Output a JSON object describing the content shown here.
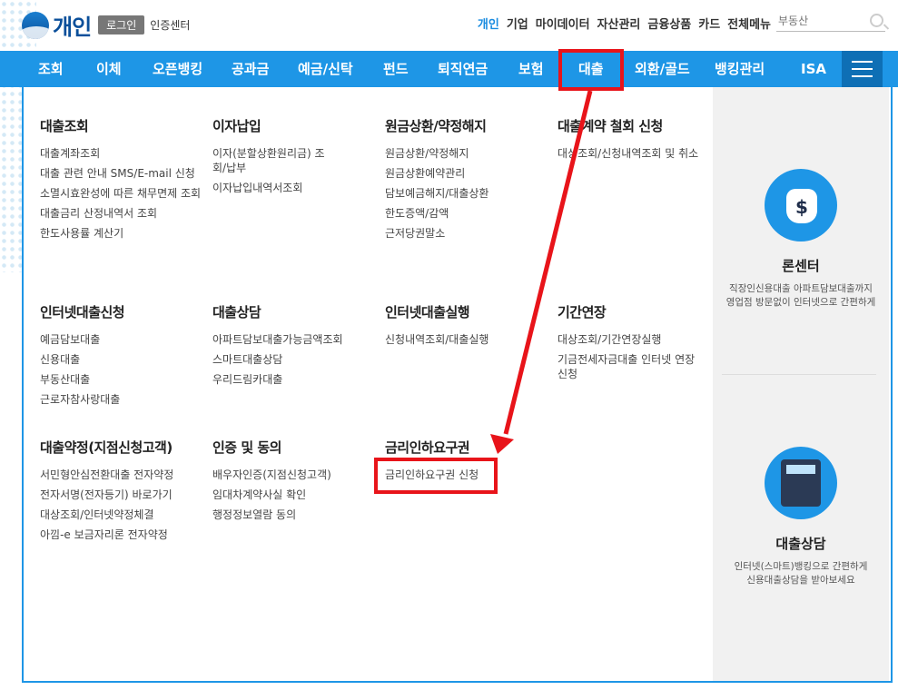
{
  "header": {
    "brand": "개인",
    "login_label": "로그인",
    "cert_label": "인증센터",
    "topnav": [
      "개인",
      "기업",
      "마이데이터",
      "자산관리",
      "금융상품",
      "카드",
      "전체메뉴"
    ],
    "search_placeholder": "부동산"
  },
  "mainnav": {
    "items": [
      "조회",
      "이체",
      "오픈뱅킹",
      "공과금",
      "예금/신탁",
      "펀드",
      "퇴직연금",
      "보험",
      "대출",
      "외환/골드",
      "뱅킹관리",
      "ISA"
    ]
  },
  "menu": {
    "groups": [
      {
        "title": "대출조회",
        "items": [
          "대출계좌조회",
          "대출 관련 안내 SMS/E-mail 신청",
          "소멸시효완성에 따른 채무면제 조회",
          "대출금리 산정내역서 조회",
          "한도사용률 계산기"
        ]
      },
      {
        "title": "이자납입",
        "items": [
          "이자(분할상환원리금) 조회/납부",
          "이자납입내역서조회"
        ]
      },
      {
        "title": "원금상환/약정해지",
        "items": [
          "원금상환/약정해지",
          "원금상환예약관리",
          "담보예금해지/대출상환",
          "한도증액/감액",
          "근저당권말소"
        ]
      },
      {
        "title": "대출계약 철회 신청",
        "items": [
          "대상조회/신청내역조회 및 취소"
        ]
      },
      {
        "title": "인터넷대출신청",
        "items": [
          "예금담보대출",
          "신용대출",
          "부동산대출",
          "근로자참사랑대출"
        ]
      },
      {
        "title": "대출상담",
        "items": [
          "아파트담보대출가능금액조회",
          "스마트대출상담",
          "우리드림카대출"
        ]
      },
      {
        "title": "인터넷대출실행",
        "items": [
          "신청내역조회/대출실행"
        ]
      },
      {
        "title": "기간연장",
        "items": [
          "대상조회/기간연장실행",
          "기금전세자금대출 인터넷 연장신청"
        ]
      },
      {
        "title": "대출약정(지점신청고객)",
        "items": [
          "서민형안심전환대출 전자약정",
          "전자서명(전자등기) 바로가기",
          "대상조회/인터넷약정체결",
          "아낌-e 보금자리론 전자약정"
        ]
      },
      {
        "title": "인증 및 동의",
        "items": [
          "배우자인증(지점신청고객)",
          "임대차계약사실 확인",
          "행정정보열람 동의"
        ]
      },
      {
        "title": "금리인하요구권",
        "items": [
          "금리인하요구권 신청"
        ]
      }
    ]
  },
  "sidebar": {
    "cards": [
      {
        "title": "론센터",
        "desc1": "직장인신용대출 아파트담보대출까지",
        "desc2": "영업점 방문없이 인터넷으로 간편하게",
        "icon": "money-bag-icon"
      },
      {
        "title": "대출상담",
        "desc1": "인터넷(스마트)뱅킹으로 간편하게",
        "desc2": "신용대출상담을 받아보세요",
        "icon": "calculator-icon"
      }
    ]
  },
  "colors": {
    "nav_blue": "#1e96e6",
    "active_blue": "#1a8ce0",
    "annotation_red": "#e8141a"
  }
}
